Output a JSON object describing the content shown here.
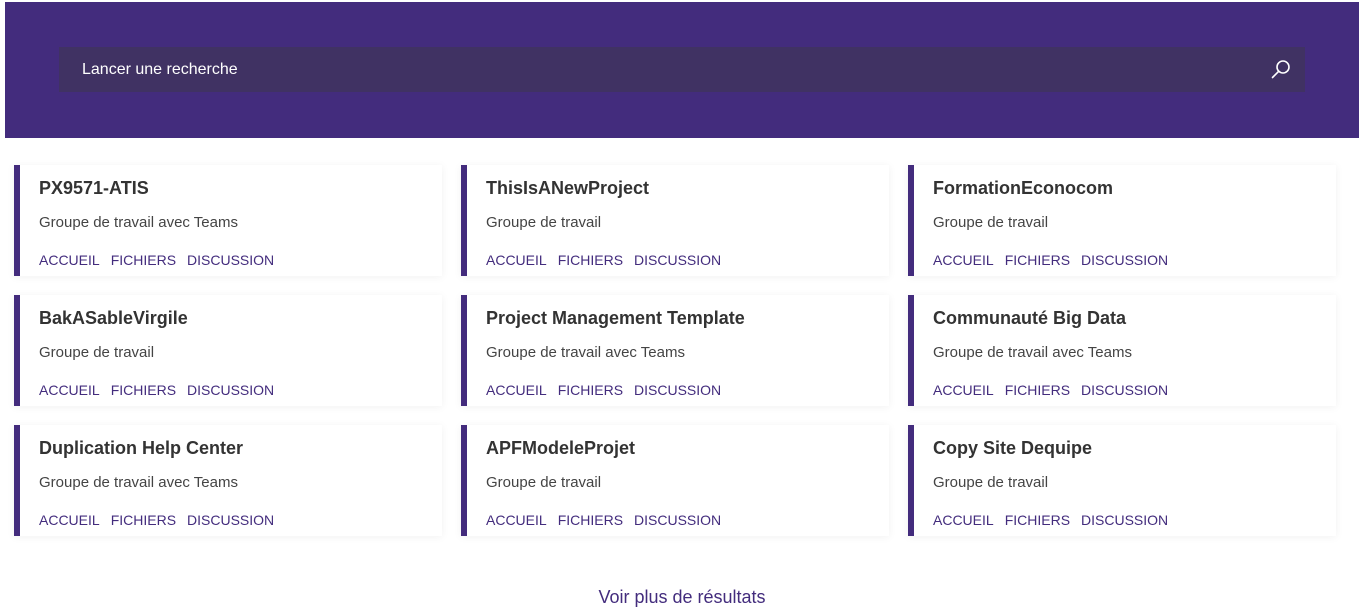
{
  "search": {
    "placeholder": "Lancer une recherche",
    "icon": "search-icon"
  },
  "theme": {
    "accent": "#432c7d",
    "search_bg": "#403263"
  },
  "sites": [
    {
      "title": "PX9571-ATIS",
      "subtitle": "Groupe de travail avec Teams",
      "links": [
        "ACCUEIL",
        "FICHIERS",
        "DISCUSSION"
      ]
    },
    {
      "title": "ThisIsANewProject",
      "subtitle": "Groupe de travail",
      "links": [
        "ACCUEIL",
        "FICHIERS",
        "DISCUSSION"
      ]
    },
    {
      "title": "FormationEconocom",
      "subtitle": "Groupe de travail",
      "links": [
        "ACCUEIL",
        "FICHIERS",
        "DISCUSSION"
      ]
    },
    {
      "title": "BakASableVirgile",
      "subtitle": "Groupe de travail",
      "links": [
        "ACCUEIL",
        "FICHIERS",
        "DISCUSSION"
      ]
    },
    {
      "title": "Project Management Template",
      "subtitle": "Groupe de travail avec Teams",
      "links": [
        "ACCUEIL",
        "FICHIERS",
        "DISCUSSION"
      ]
    },
    {
      "title": "Communauté Big Data",
      "subtitle": "Groupe de travail avec Teams",
      "links": [
        "ACCUEIL",
        "FICHIERS",
        "DISCUSSION"
      ]
    },
    {
      "title": "Duplication Help Center",
      "subtitle": "Groupe de travail avec Teams",
      "links": [
        "ACCUEIL",
        "FICHIERS",
        "DISCUSSION"
      ]
    },
    {
      "title": "APFModeleProjet",
      "subtitle": "Groupe de travail",
      "links": [
        "ACCUEIL",
        "FICHIERS",
        "DISCUSSION"
      ]
    },
    {
      "title": "Copy Site Dequipe",
      "subtitle": "Groupe de travail",
      "links": [
        "ACCUEIL",
        "FICHIERS",
        "DISCUSSION"
      ]
    }
  ],
  "more_results": "Voir plus de résultats"
}
